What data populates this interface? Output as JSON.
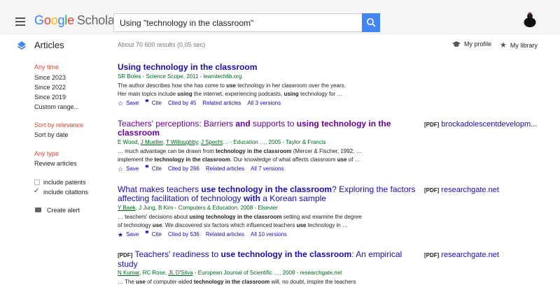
{
  "header": {
    "logo_google": [
      "G",
      "o",
      "o",
      "g",
      "l",
      "e"
    ],
    "logo_scholar": "Scholar",
    "search_value": "Using \"technology in the classroom\""
  },
  "subheader": {
    "section": "Articles",
    "results_count": "About 70 600 results (0,05 sec)",
    "my_profile": "My profile",
    "my_library": "My library"
  },
  "sidebar": {
    "time_heading": "Any time",
    "time_options": [
      "Since 2023",
      "Since 2022",
      "Since 2019",
      "Custom range..."
    ],
    "sort_relevance": "Sort by relevance",
    "sort_date": "Sort by date",
    "type_heading": "Any type",
    "type_review": "Review articles",
    "include_patents": "include patents",
    "include_citations": "include citations",
    "create_alert": "Create alert"
  },
  "colors": {
    "accent": "#4285f4",
    "link": "#1a0dab",
    "visited": "#660099",
    "meta": "#006621",
    "sidebar_active": "#d14836"
  },
  "results": [
    {
      "title": "Using technology in the classroom",
      "meta": "SR Boles - Science Scope, 2011 - learntechlib.org",
      "snippet1_a": "The author describes how she has come to ",
      "snippet1_b": "use",
      "snippet1_c": " technology in her classroom over the years.",
      "snippet2_a": "Her main topics include ",
      "snippet2_b": "using",
      "snippet2_c": " the internet, experiencing podcasts, ",
      "snippet2_d": "using",
      "snippet2_e": " technology for …",
      "save": "Save",
      "cite": "Cite",
      "cited_by": "Cited by 45",
      "related": "Related articles",
      "versions": "All 3 versions"
    },
    {
      "title_a": "Teachers' perceptions: Barriers ",
      "title_b": "and",
      "title_c": " supports to ",
      "title_d": "using technology in the",
      "title_e": "classroom",
      "meta_a": "E Wood, ",
      "meta_b": "J Mueller",
      "meta_c": ", ",
      "meta_d": "T Willoughby",
      "meta_e": ", ",
      "meta_f": "J Specht",
      "meta_g": "… - Education …, 2005 - Taylor & Francis",
      "snippet1_a": "… much advantage can be drawn from ",
      "snippet1_b": "technology in the classroom",
      "snippet1_c": " (Mercer & Fischer, 1992; …",
      "snippet2_a": "implement the ",
      "snippet2_b": "technology in the classroom",
      "snippet2_c": ". Our knowledge of what affects classroom ",
      "snippet2_d": "use",
      "snippet2_e": " of …",
      "save": "Save",
      "cite": "Cite",
      "cited_by": "Cited by 266",
      "related": "Related articles",
      "versions": "All 7 versions",
      "side_pdf": "[PDF]",
      "side_url": "brockadolescentdevelopm..."
    },
    {
      "title_a": "What makes teachers ",
      "title_b": "use technology in the classroom",
      "title_c": "? Exploring the factors",
      "title_d": "affecting facilitation of technology ",
      "title_e": "with",
      "title_f": " a Korean sample",
      "meta_a": "Y Baek",
      "meta_b": ", J Jung, B Kim - Computers & Education, 2008 - Elsevier",
      "snippet1_a": "… teachers' decisions about ",
      "snippet1_b": "using technology in the classroom",
      "snippet1_c": " setting and examine the degree",
      "snippet2_a": "of technology ",
      "snippet2_b": "use",
      "snippet2_c": ". We discovered six factors which influenced teachers ",
      "snippet2_d": "use",
      "snippet2_e": " technology in …",
      "save": "Save",
      "cite": "Cite",
      "cited_by": "Cited by 536",
      "related": "Related articles",
      "versions": "All 10 versions",
      "side_pdf": "[PDF]",
      "side_url": "researchgate.net"
    },
    {
      "pdf_tag": "[PDF]",
      "title_a": " Teachers' readiness to ",
      "title_b": "use technology in the classroom",
      "title_c": ": An empirical",
      "title_d": "study",
      "meta_a": "N Kumar",
      "meta_b": ", RC Rose, ",
      "meta_c": "JL D'Silva",
      "meta_d": " - European Journal of Scientific …, 2008 - researchgate.net",
      "snippet1_a": "… The ",
      "snippet1_b": "use",
      "snippet1_c": " of computer-aided ",
      "snippet1_d": "technology in the classroom",
      "snippet1_e": " will, no doubt, inspire the teachers",
      "side_pdf": "[PDF]",
      "side_url": "researchgate.net"
    }
  ]
}
